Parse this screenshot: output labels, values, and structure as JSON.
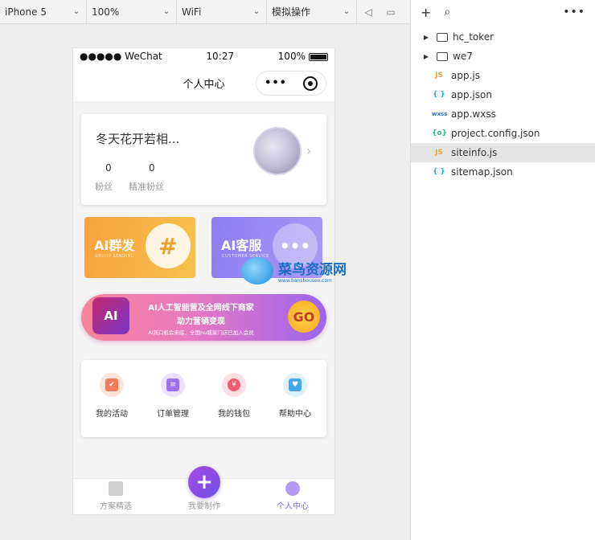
{
  "toolbar": {
    "device": "iPhone 5",
    "zoom": "100%",
    "network": "WiFi",
    "mode": "模拟操作"
  },
  "panel": {
    "add_icon": "plus-icon",
    "search_icon": "search-icon",
    "more_icon": "more-icon",
    "files": [
      {
        "name": "hc_toker",
        "type": "folder"
      },
      {
        "name": "we7",
        "type": "folder"
      },
      {
        "name": "app.js",
        "type": "js"
      },
      {
        "name": "app.json",
        "type": "json"
      },
      {
        "name": "app.wxss",
        "type": "wxss"
      },
      {
        "name": "project.config.json",
        "type": "config"
      },
      {
        "name": "siteinfo.js",
        "type": "js",
        "selected": true
      },
      {
        "name": "sitemap.json",
        "type": "json"
      }
    ],
    "icon_labels": {
      "js": "JS",
      "json": "{ }",
      "wxss": "wxss",
      "config": "{o}"
    }
  },
  "phone": {
    "status": {
      "carrier": "●●●●● WeChat",
      "time": "10:27",
      "battery": "100%"
    },
    "nav_title": "个人中心",
    "user": {
      "name": "冬天花开若相...",
      "fans_count": "0",
      "fans_label": "粉丝",
      "precise_count": "0",
      "precise_label": "精准粉丝"
    },
    "promos": [
      {
        "title": "AI群发",
        "subtitle": "GROUP SENDING",
        "icon": "#"
      },
      {
        "title": "AI客服",
        "subtitle": "CUSTOMER SERVICE",
        "icon": "•••"
      }
    ],
    "banner": {
      "badge": "AI",
      "line1": "AI人工智能营及全网线下商家",
      "line2": "助力营销变现",
      "line3": "AI风口机会来临，全国nu城家门店已加入会员",
      "go": "GO"
    },
    "menu": [
      {
        "label": "我的活动",
        "color": "#f47b5a",
        "glyph": "✔"
      },
      {
        "label": "订单管理",
        "color": "#a06ef0",
        "glyph": "≡"
      },
      {
        "label": "我的钱包",
        "color": "#f05a6e",
        "glyph": "¥"
      },
      {
        "label": "帮助中心",
        "color": "#46a8e8",
        "glyph": "♥"
      }
    ],
    "tabs": [
      {
        "label": "方案精选"
      },
      {
        "label": "我要制作"
      },
      {
        "label": "个人中心"
      }
    ],
    "plus": "+"
  },
  "watermark": {
    "title": "菜鸟资源网",
    "url": "www.banshouseo.com"
  },
  "colors": {
    "accent": "#7b68ee",
    "orange": "#f7a23d",
    "purple": "#8d7cf0"
  }
}
